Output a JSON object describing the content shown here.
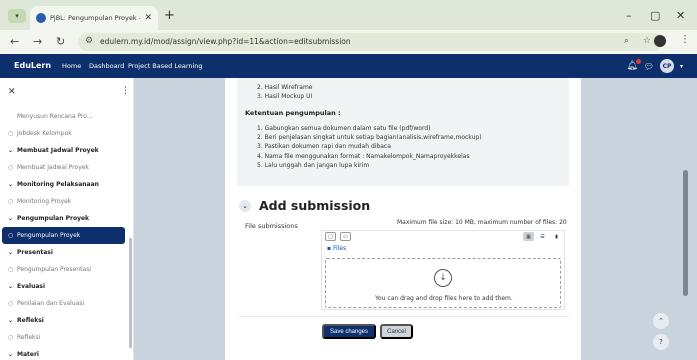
{
  "browser": {
    "tab_title": "PjBL: Pengumpulan Proyek - Edu",
    "new_tab": "+",
    "url": "edulern.my.id/mod/assign/view.php?id=11&action=editsubmission",
    "min": "–",
    "max": "▢",
    "close": "✕"
  },
  "navbar": {
    "brand": "EduLern",
    "links": [
      "Home",
      "Dashboard",
      "Project Based Learning"
    ],
    "avatar_initials": "CP"
  },
  "sidebar": {
    "items": [
      {
        "label": "Menyusun Rencana Pro...",
        "type": "sub"
      },
      {
        "label": "Jobdesk Kelompok",
        "type": "activity"
      },
      {
        "label": "Membuat Jadwal Proyek",
        "type": "section"
      },
      {
        "label": "Membuat Jadwal Proyek",
        "type": "activity"
      },
      {
        "label": "Monitoring Pelaksanaan",
        "type": "section"
      },
      {
        "label": "Monitoring Proyek",
        "type": "activity"
      },
      {
        "label": "Pengumpulan Proyek",
        "type": "section"
      },
      {
        "label": "Pengumpulan Proyek",
        "type": "active"
      },
      {
        "label": "Presentasi",
        "type": "section"
      },
      {
        "label": "Pengumpulan Presentasi",
        "type": "activity"
      },
      {
        "label": "Evaluasi",
        "type": "section"
      },
      {
        "label": "Penilaian dan Evaluasi",
        "type": "activity"
      },
      {
        "label": "Refleksi",
        "type": "section"
      },
      {
        "label": "Refleksi",
        "type": "activity"
      },
      {
        "label": "Materi",
        "type": "section"
      }
    ]
  },
  "content": {
    "list_top": [
      "2. Hasil Wireframe",
      "3. Hasil Mockup UI"
    ],
    "ketentuan_heading": "Ketentuan pengumpulan :",
    "ketentuan": [
      "1. Gabungkan semua dokumen dalam satu file (pdf/word)",
      "2. Beri penjelasan singkat untuk setiap bagian(analisis,wireframe,mockup)",
      "3. Pastikan dokumen rapi dan mudah dibaca",
      "4. Nama file menggunakan format : Namakelompok_Namaproyekkelas",
      "5. Lalu unggah dan jangan lupa kirim"
    ],
    "add_submission": "Add submission",
    "file_submissions_label": "File submissions",
    "max_note": "Maximum file size: 10 MB, maximum number of files: 20",
    "files_crumb": "Files",
    "drop_text": "You can drag and drop files here to add them.",
    "save_label": "Save changes",
    "cancel_label": "Cancel"
  }
}
